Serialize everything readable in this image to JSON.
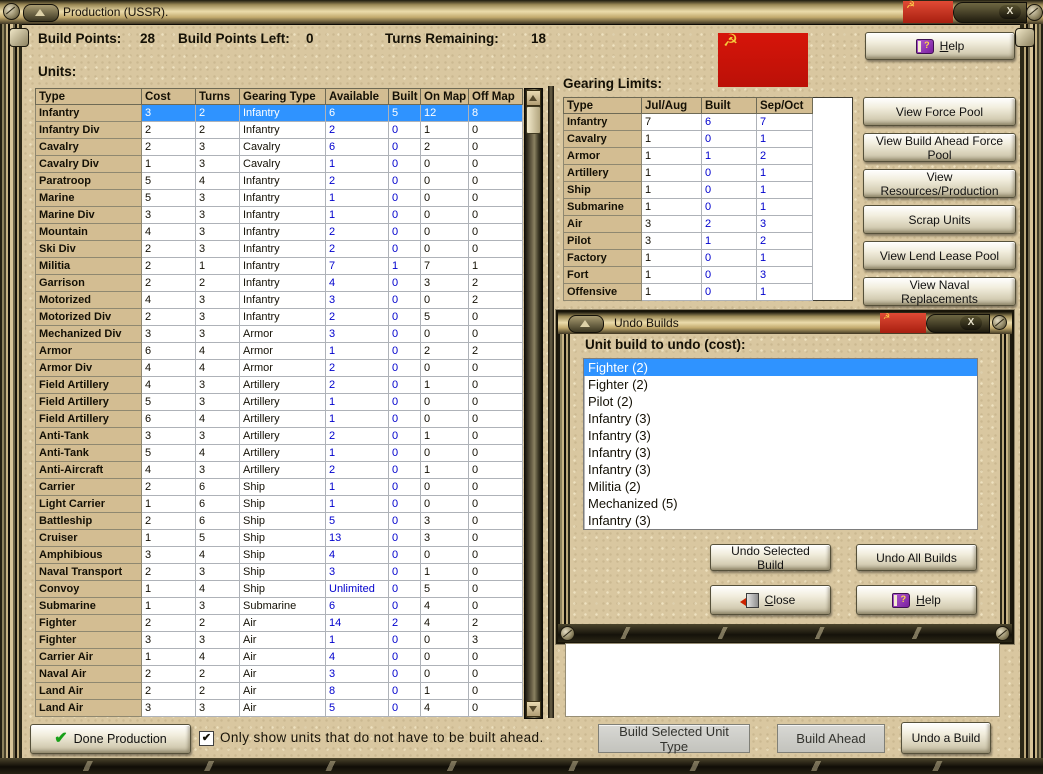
{
  "window": {
    "title": "Production (USSR).",
    "close_label": "X"
  },
  "header": {
    "build_points_label": "Build Points:",
    "build_points": "28",
    "build_points_left_label": "Build Points Left:",
    "build_points_left": "0",
    "turns_remaining_label": "Turns Remaining:",
    "turns_remaining": "18"
  },
  "flag": {
    "name": "ussr-flag",
    "emblem": "☭"
  },
  "help_button": {
    "label": "Help"
  },
  "side_buttons": [
    "View Force Pool",
    "View Build Ahead Force Pool",
    "View Resources/Production",
    "Scrap Units",
    "View Lend Lease Pool",
    "View Naval Replacements"
  ],
  "units": {
    "label": "Units:",
    "columns": [
      "Type",
      "Cost",
      "Turns",
      "Gearing Type",
      "Available",
      "Built",
      "On Map",
      "Off Map"
    ],
    "rows": [
      {
        "type": "Infantry",
        "cost": 3,
        "turns": 2,
        "gearing": "Infantry",
        "available": "6",
        "built": 5,
        "on_map": 12,
        "off_map": 8,
        "selected": true
      },
      {
        "type": "Infantry Div",
        "cost": 2,
        "turns": 2,
        "gearing": "Infantry",
        "available": "2",
        "built": 0,
        "on_map": 1,
        "off_map": 0
      },
      {
        "type": "Cavalry",
        "cost": 2,
        "turns": 3,
        "gearing": "Cavalry",
        "available": "6",
        "built": 0,
        "on_map": 2,
        "off_map": 0
      },
      {
        "type": "Cavalry Div",
        "cost": 1,
        "turns": 3,
        "gearing": "Cavalry",
        "available": "1",
        "built": 0,
        "on_map": 0,
        "off_map": 0
      },
      {
        "type": "Paratroop",
        "cost": 5,
        "turns": 4,
        "gearing": "Infantry",
        "available": "2",
        "built": 0,
        "on_map": 0,
        "off_map": 0
      },
      {
        "type": "Marine",
        "cost": 5,
        "turns": 3,
        "gearing": "Infantry",
        "available": "1",
        "built": 0,
        "on_map": 0,
        "off_map": 0
      },
      {
        "type": "Marine Div",
        "cost": 3,
        "turns": 3,
        "gearing": "Infantry",
        "available": "1",
        "built": 0,
        "on_map": 0,
        "off_map": 0
      },
      {
        "type": "Mountain",
        "cost": 4,
        "turns": 3,
        "gearing": "Infantry",
        "available": "2",
        "built": 0,
        "on_map": 0,
        "off_map": 0
      },
      {
        "type": "Ski Div",
        "cost": 2,
        "turns": 3,
        "gearing": "Infantry",
        "available": "2",
        "built": 0,
        "on_map": 0,
        "off_map": 0
      },
      {
        "type": "Militia",
        "cost": 2,
        "turns": 1,
        "gearing": "Infantry",
        "available": "7",
        "built": 1,
        "on_map": 7,
        "off_map": 1
      },
      {
        "type": "Garrison",
        "cost": 2,
        "turns": 2,
        "gearing": "Infantry",
        "available": "4",
        "built": 0,
        "on_map": 3,
        "off_map": 2
      },
      {
        "type": "Motorized",
        "cost": 4,
        "turns": 3,
        "gearing": "Infantry",
        "available": "3",
        "built": 0,
        "on_map": 0,
        "off_map": 2
      },
      {
        "type": "Motorized Div",
        "cost": 2,
        "turns": 3,
        "gearing": "Infantry",
        "available": "2",
        "built": 0,
        "on_map": 5,
        "off_map": 0
      },
      {
        "type": "Mechanized Div",
        "cost": 3,
        "turns": 3,
        "gearing": "Armor",
        "available": "3",
        "built": 0,
        "on_map": 0,
        "off_map": 0
      },
      {
        "type": "Armor",
        "cost": 6,
        "turns": 4,
        "gearing": "Armor",
        "available": "1",
        "built": 0,
        "on_map": 2,
        "off_map": 2
      },
      {
        "type": "Armor Div",
        "cost": 4,
        "turns": 4,
        "gearing": "Armor",
        "available": "2",
        "built": 0,
        "on_map": 0,
        "off_map": 0
      },
      {
        "type": "Field Artillery",
        "cost": 4,
        "turns": 3,
        "gearing": "Artillery",
        "available": "2",
        "built": 0,
        "on_map": 1,
        "off_map": 0
      },
      {
        "type": "Field Artillery",
        "cost": 5,
        "turns": 3,
        "gearing": "Artillery",
        "available": "1",
        "built": 0,
        "on_map": 0,
        "off_map": 0
      },
      {
        "type": "Field Artillery",
        "cost": 6,
        "turns": 4,
        "gearing": "Artillery",
        "available": "1",
        "built": 0,
        "on_map": 0,
        "off_map": 0
      },
      {
        "type": "Anti-Tank",
        "cost": 3,
        "turns": 3,
        "gearing": "Artillery",
        "available": "2",
        "built": 0,
        "on_map": 1,
        "off_map": 0
      },
      {
        "type": "Anti-Tank",
        "cost": 5,
        "turns": 4,
        "gearing": "Artillery",
        "available": "1",
        "built": 0,
        "on_map": 0,
        "off_map": 0
      },
      {
        "type": "Anti-Aircraft",
        "cost": 4,
        "turns": 3,
        "gearing": "Artillery",
        "available": "2",
        "built": 0,
        "on_map": 1,
        "off_map": 0
      },
      {
        "type": "Carrier",
        "cost": 2,
        "turns": 6,
        "gearing": "Ship",
        "available": "1",
        "built": 0,
        "on_map": 0,
        "off_map": 0
      },
      {
        "type": "Light Carrier",
        "cost": 1,
        "turns": 6,
        "gearing": "Ship",
        "available": "1",
        "built": 0,
        "on_map": 0,
        "off_map": 0
      },
      {
        "type": "Battleship",
        "cost": 2,
        "turns": 6,
        "gearing": "Ship",
        "available": "5",
        "built": 0,
        "on_map": 3,
        "off_map": 0
      },
      {
        "type": "Cruiser",
        "cost": 1,
        "turns": 5,
        "gearing": "Ship",
        "available": "13",
        "built": 0,
        "on_map": 3,
        "off_map": 0
      },
      {
        "type": "Amphibious",
        "cost": 3,
        "turns": 4,
        "gearing": "Ship",
        "available": "4",
        "built": 0,
        "on_map": 0,
        "off_map": 0
      },
      {
        "type": "Naval Transport",
        "cost": 2,
        "turns": 3,
        "gearing": "Ship",
        "available": "3",
        "built": 0,
        "on_map": 1,
        "off_map": 0
      },
      {
        "type": "Convoy",
        "cost": 1,
        "turns": 4,
        "gearing": "Ship",
        "available": "Unlimited",
        "built": 0,
        "on_map": 5,
        "off_map": 0
      },
      {
        "type": "Submarine",
        "cost": 1,
        "turns": 3,
        "gearing": "Submarine",
        "available": "6",
        "built": 0,
        "on_map": 4,
        "off_map": 0
      },
      {
        "type": "Fighter",
        "cost": 2,
        "turns": 2,
        "gearing": "Air",
        "available": "14",
        "built": 2,
        "on_map": 4,
        "off_map": 2
      },
      {
        "type": "Fighter",
        "cost": 3,
        "turns": 3,
        "gearing": "Air",
        "available": "1",
        "built": 0,
        "on_map": 0,
        "off_map": 3
      },
      {
        "type": "Carrier Air",
        "cost": 1,
        "turns": 4,
        "gearing": "Air",
        "available": "4",
        "built": 0,
        "on_map": 0,
        "off_map": 0
      },
      {
        "type": "Naval Air",
        "cost": 2,
        "turns": 2,
        "gearing": "Air",
        "available": "3",
        "built": 0,
        "on_map": 0,
        "off_map": 0
      },
      {
        "type": "Land Air",
        "cost": 2,
        "turns": 2,
        "gearing": "Air",
        "available": "8",
        "built": 0,
        "on_map": 1,
        "off_map": 0
      },
      {
        "type": "Land Air",
        "cost": 3,
        "turns": 3,
        "gearing": "Air",
        "available": "5",
        "built": 0,
        "on_map": 4,
        "off_map": 0
      }
    ]
  },
  "gearing": {
    "label": "Gearing Limits:",
    "columns": [
      "Type",
      "Jul/Aug",
      "Built",
      "Sep/Oct"
    ],
    "rows": [
      {
        "type": "Infantry",
        "julaug": 7,
        "built": 6,
        "sepoct": 7
      },
      {
        "type": "Cavalry",
        "julaug": 1,
        "built": 0,
        "sepoct": 1
      },
      {
        "type": "Armor",
        "julaug": 1,
        "built": 1,
        "sepoct": 2
      },
      {
        "type": "Artillery",
        "julaug": 1,
        "built": 0,
        "sepoct": 1
      },
      {
        "type": "Ship",
        "julaug": 1,
        "built": 0,
        "sepoct": 1
      },
      {
        "type": "Submarine",
        "julaug": 1,
        "built": 0,
        "sepoct": 1
      },
      {
        "type": "Air",
        "julaug": 3,
        "built": 2,
        "sepoct": 3
      },
      {
        "type": "Pilot",
        "julaug": 3,
        "built": 1,
        "sepoct": 2
      },
      {
        "type": "Factory",
        "julaug": 1,
        "built": 0,
        "sepoct": 1
      },
      {
        "type": "Fort",
        "julaug": 1,
        "built": 0,
        "sepoct": 3
      },
      {
        "type": "Offensive",
        "julaug": 1,
        "built": 0,
        "sepoct": 1
      }
    ]
  },
  "undo_dialog": {
    "title": "Undo Builds",
    "close_label": "X",
    "label": "Unit build to undo (cost):",
    "items": [
      "Fighter (2)",
      "Fighter (2)",
      "Pilot (2)",
      "Infantry (3)",
      "Infantry (3)",
      "Infantry (3)",
      "Infantry (3)",
      "Militia (2)",
      "Mechanized (5)",
      "Infantry (3)"
    ],
    "selected_index": 0,
    "buttons": {
      "undo_selected": "Undo Selected Build",
      "undo_all": "Undo All Builds",
      "close": "Close",
      "help": "Help"
    }
  },
  "bottom": {
    "done_label": "Done Production",
    "checkbox_checked": true,
    "checkbox_label": "Only show units that do not have to be built ahead.",
    "build_selected_label": "Build Selected Unit Type",
    "build_ahead_label": "Build Ahead",
    "undo_build_label": "Undo a Build"
  },
  "colors": {
    "selection_blue": "#2f93ff",
    "value_blue": "#0000cd",
    "flag_red": "#d6150a",
    "parchment": "#d9c7a0",
    "title_gold": "#ecdcab",
    "header_tan": "#d3bd92"
  }
}
